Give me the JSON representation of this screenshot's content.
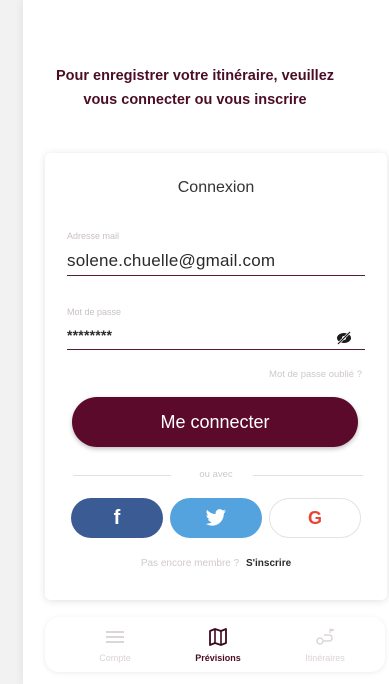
{
  "intro": {
    "line1": "Pour enregistrer votre itinéraire, veuillez",
    "line2": "vous connecter ou vous inscrire"
  },
  "login": {
    "title": "Connexion",
    "email_label": "Adresse mail",
    "email_value": "solene.chuelle@gmail.com",
    "password_label": "Mot de passe",
    "password_value": "********",
    "forgot_label": "Mot de passe oublié ?",
    "submit_label": "Me connecter",
    "divider_label": "ou avec"
  },
  "social": {
    "facebook_glyph": "f",
    "google_glyph": "G"
  },
  "signup": {
    "prompt": "Pas encore membre ?",
    "link": "S'inscrire"
  },
  "tabs": [
    {
      "label": "Compte",
      "icon": "menu-icon",
      "active": false
    },
    {
      "label": "Prévisions",
      "icon": "map-icon",
      "active": true
    },
    {
      "label": "Itinéraires",
      "icon": "route-icon",
      "active": false
    }
  ],
  "colors": {
    "brand": "#5b0a2b",
    "facebook": "#3b5b94",
    "twitter": "#54a3de"
  }
}
